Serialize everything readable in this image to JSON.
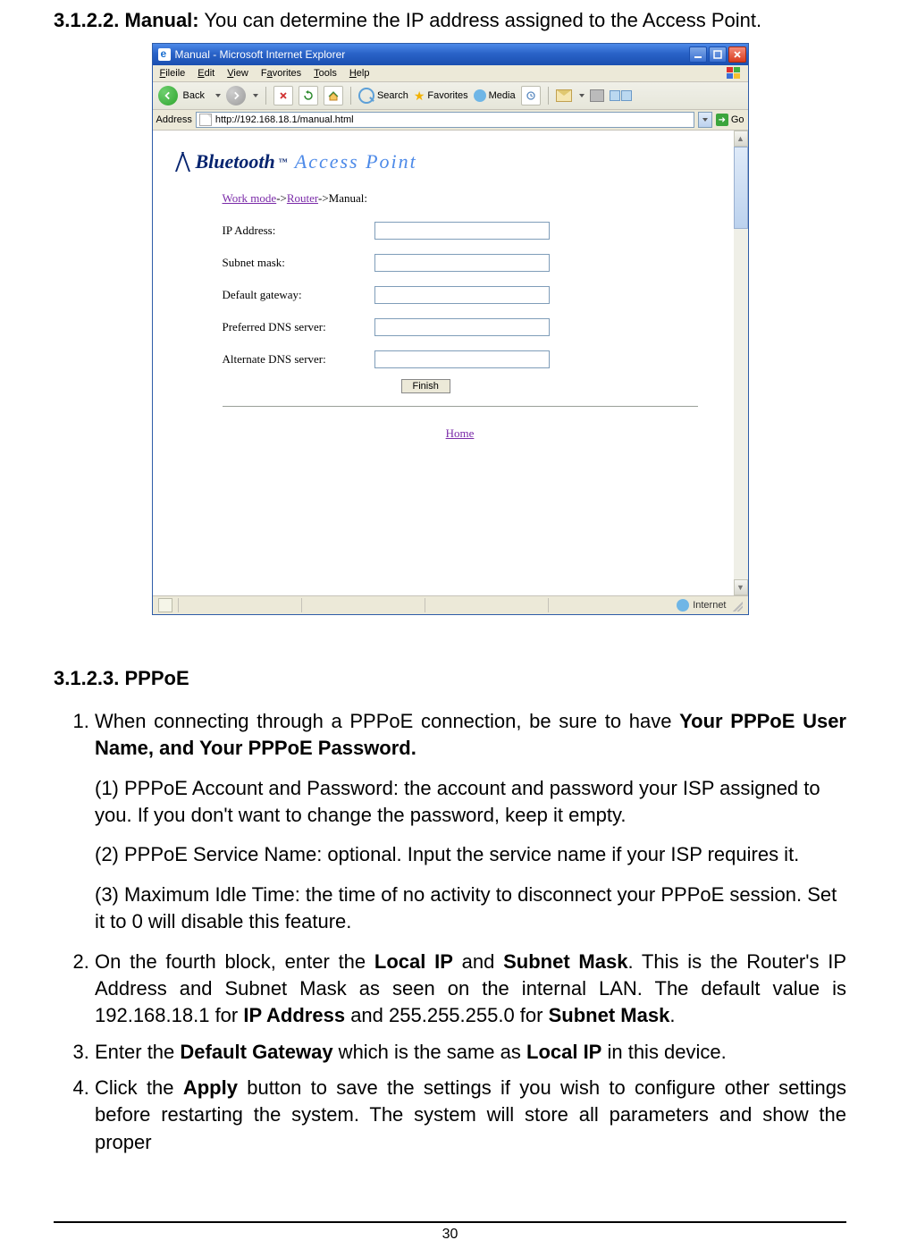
{
  "doc": {
    "heading_label": "3.1.2.2. Manual:",
    "heading_text": " You can determine the IP address assigned to the Access Point.",
    "section_2_heading": "3.1.2.3. PPPoE",
    "li1_prefix": "When connecting through a PPPoE connection, be sure to have ",
    "li1_bold": "Your PPPoE User Name, and Your PPPoE Password.",
    "p1": "(1) PPPoE Account and Password: the account and password your ISP assigned to you. If you don't want to change the password, keep it empty.",
    "p2": "(2) PPPoE Service Name: optional. Input the service name if your ISP requires it.",
    "p3": "(3) Maximum Idle Time: the time of no activity to disconnect your PPPoE session. Set it to 0 will disable this feature.",
    "li2_a": "On the fourth block, enter the ",
    "li2_b1": "Local IP",
    "li2_b": " and ",
    "li2_b2": "Subnet Mask",
    "li2_c": ". This is the Router's IP Address and Subnet Mask as seen on the internal LAN. The default value is 192.168.18.1 for ",
    "li2_b3": "IP Address",
    "li2_d": " and 255.255.255.0 for ",
    "li2_b4": "Subnet Mask",
    "li2_e": ".",
    "li3_a": "Enter the ",
    "li3_b1": "Default Gateway",
    "li3_b": " which is the same as ",
    "li3_b2": "Local IP",
    "li3_c": " in this device.",
    "li4_a": "Click the ",
    "li4_b1": "Apply",
    "li4_b": " button to save the settings if you wish to configure other settings before restarting the system. The system will store all parameters and show the proper",
    "page_number": "30"
  },
  "ie": {
    "title": "Manual - Microsoft Internet Explorer",
    "menu": {
      "file": "File",
      "edit": "Edit",
      "view": "View",
      "favorites": "Favorites",
      "tools": "Tools",
      "help": "Help"
    },
    "toolbar": {
      "back": "Back",
      "search": "Search",
      "favorites": "Favorites",
      "media": "Media"
    },
    "address_label": "Address",
    "address_value": "http://192.168.18.1/manual.html",
    "go_label": "Go",
    "status_zone": "Internet"
  },
  "ap": {
    "brand": "Bluetooth",
    "brand_sub": "Access Point",
    "bc_workmode": "Work mode",
    "bc_router": "Router",
    "bc_manual": "Manual:",
    "labels": {
      "ip": "IP Address:",
      "subnet": "Subnet mask:",
      "gateway": "Default gateway:",
      "dns1": "Preferred DNS server:",
      "dns2": "Alternate DNS server:"
    },
    "finish_btn": "Finish",
    "home_link": "Home"
  }
}
